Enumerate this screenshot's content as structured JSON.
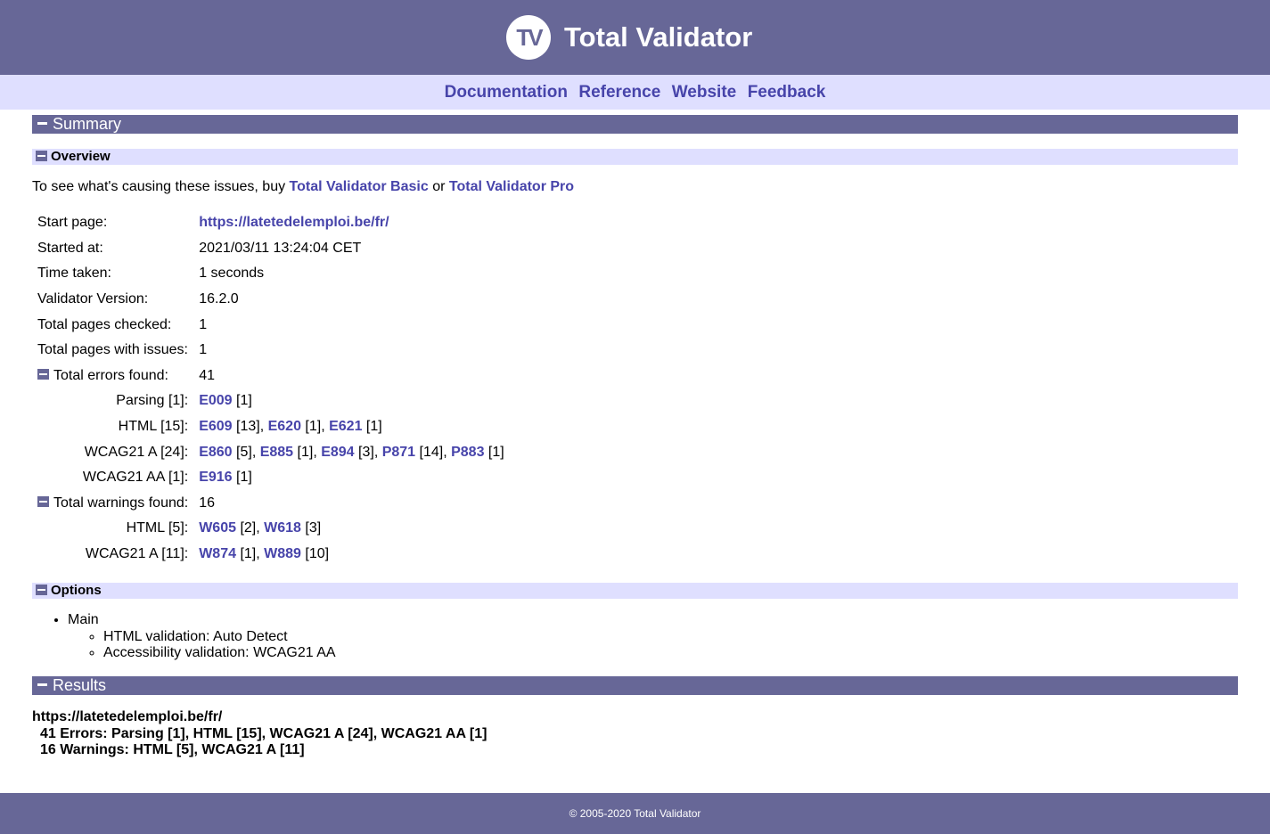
{
  "header": {
    "logo_text": "TV",
    "title": "Total Validator"
  },
  "nav": {
    "links": [
      "Documentation",
      "Reference",
      "Website",
      "Feedback"
    ]
  },
  "sections": {
    "summary": "Summary",
    "overview": "Overview",
    "options": "Options",
    "results": "Results"
  },
  "overview": {
    "intro_prefix": "To see what's causing these issues, buy ",
    "basic_link": "Total Validator Basic",
    "intro_or": " or ",
    "pro_link": "Total Validator Pro",
    "start_page_label": "Start page:",
    "start_page": "https://latetedelemploi.be/fr/",
    "started_at_label": "Started at:",
    "started_at": "2021/03/11 13:24:04 CET",
    "time_taken_label": "Time taken:",
    "time_taken": "1 seconds",
    "version_label": "Validator Version:",
    "version": "16.2.0",
    "pages_checked_label": "Total pages checked:",
    "pages_checked": "1",
    "pages_issues_label": "Total pages with issues:",
    "pages_issues": "1",
    "errors_label": "Total errors found:",
    "errors_total": "41",
    "error_groups": [
      {
        "label": "Parsing [1]:",
        "items": [
          {
            "code": "E009",
            "count": " [1]"
          }
        ]
      },
      {
        "label": "HTML [15]:",
        "items": [
          {
            "code": "E609",
            "count": " [13], "
          },
          {
            "code": "E620",
            "count": " [1], "
          },
          {
            "code": "E621",
            "count": " [1]"
          }
        ]
      },
      {
        "label": "WCAG21 A [24]:",
        "items": [
          {
            "code": "E860",
            "count": " [5], "
          },
          {
            "code": "E885",
            "count": " [1], "
          },
          {
            "code": "E894",
            "count": " [3], "
          },
          {
            "code": "P871",
            "count": " [14], "
          },
          {
            "code": "P883",
            "count": " [1]"
          }
        ]
      },
      {
        "label": "WCAG21 AA [1]:",
        "items": [
          {
            "code": "E916",
            "count": " [1]"
          }
        ]
      }
    ],
    "warnings_label": "Total warnings found:",
    "warnings_total": "16",
    "warning_groups": [
      {
        "label": "HTML [5]:",
        "items": [
          {
            "code": "W605",
            "count": " [2], "
          },
          {
            "code": "W618",
            "count": " [3]"
          }
        ]
      },
      {
        "label": "WCAG21 A [11]:",
        "items": [
          {
            "code": "W874",
            "count": " [1], "
          },
          {
            "code": "W889",
            "count": " [10]"
          }
        ]
      }
    ]
  },
  "options": {
    "main": "Main",
    "html_validation": "HTML validation: Auto Detect",
    "accessibility_validation": "Accessibility validation: WCAG21 AA"
  },
  "results": {
    "url": "https://latetedelemploi.be/fr/",
    "errors_line": "41 Errors: Parsing [1], HTML [15], WCAG21 A [24], WCAG21 AA [1]",
    "warnings_line": "16 Warnings: HTML [5], WCAG21 A [11]"
  },
  "footer": {
    "copyright": "© 2005-2020 Total Validator"
  },
  "colors": {
    "header_bg": "#676797",
    "nav_bg": "#dfdfff",
    "link": "#4744aa"
  }
}
